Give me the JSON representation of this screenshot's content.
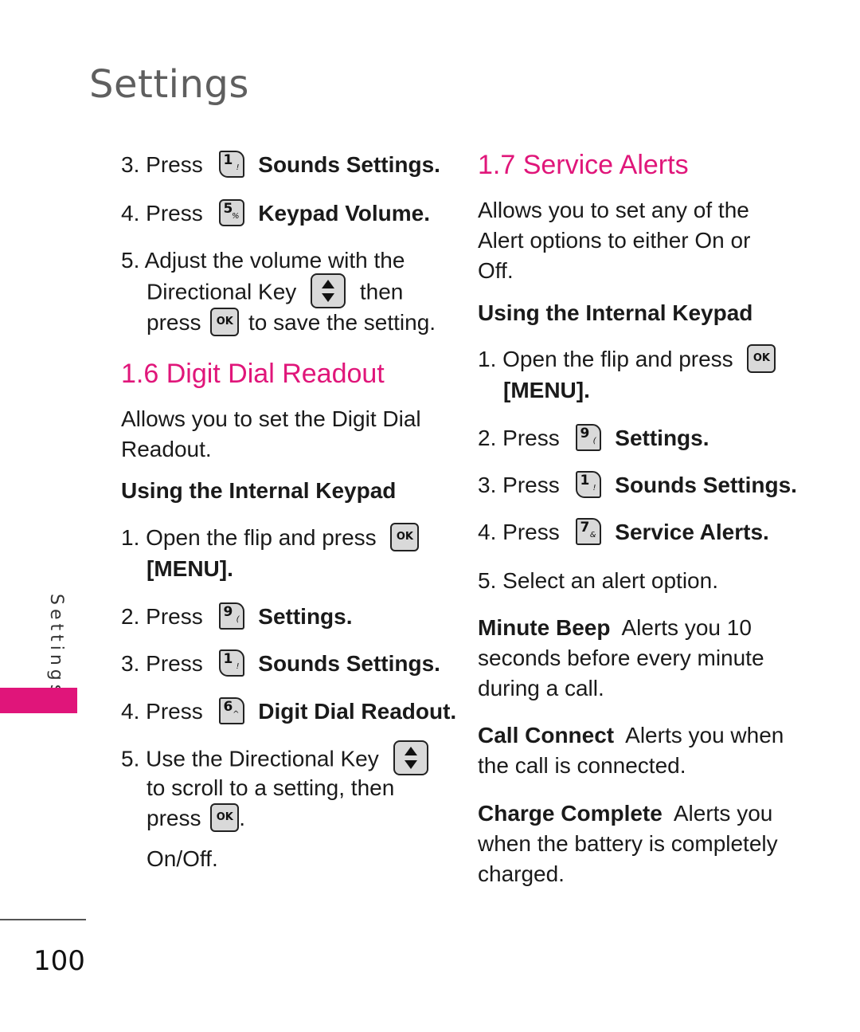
{
  "page": {
    "title": "Settings",
    "side_tab_label": "Settings",
    "page_number": "100",
    "accent_color": "#e0157a"
  },
  "left": {
    "intro_steps": [
      {
        "num": "3.",
        "prefix": "Press",
        "key": {
          "digit": "1",
          "sup": "!",
          "icon": "key-1-icon"
        },
        "label": "Sounds Settings."
      },
      {
        "num": "4.",
        "prefix": "Press",
        "key": {
          "digit": "5",
          "sup": "%",
          "icon": "key-5-icon"
        },
        "label": "Keypad Volume."
      }
    ],
    "step5": {
      "num": "5.",
      "line1": "Adjust the volume with the",
      "line2_a": "Directional Key",
      "line2_b": "then",
      "line3_a": "press",
      "line3_b": "to save the setting.",
      "ok_label": "OK"
    },
    "section": {
      "heading": "1.6 Digit Dial Readout",
      "description_l1": "Allows you to set the Digit Dial",
      "description_l2": "Readout.",
      "subheading": "Using the Internal Keypad",
      "step1": {
        "num": "1.",
        "text": "Open the flip and press",
        "ok_label": "OK",
        "menu": "[MENU]."
      },
      "steps": [
        {
          "num": "2.",
          "prefix": "Press",
          "key": {
            "digit": "9",
            "sup": "(",
            "icon": "key-9-icon"
          },
          "label": "Settings."
        },
        {
          "num": "3.",
          "prefix": "Press",
          "key": {
            "digit": "1",
            "sup": "!",
            "icon": "key-1-icon"
          },
          "label": "Sounds Settings."
        },
        {
          "num": "4.",
          "prefix": "Press",
          "key": {
            "digit": "6",
            "sup": "^",
            "icon": "key-6-icon"
          },
          "label": "Digit Dial Readout."
        }
      ],
      "step5": {
        "num": "5.",
        "line1": "Use the Directional Key",
        "line2": "to scroll to a setting, then",
        "line3": "press",
        "line3_end": ".",
        "ok_label": "OK",
        "option": "On/Off."
      }
    }
  },
  "right": {
    "section": {
      "heading": "1.7 Service Alerts",
      "description": [
        "Allows you to set any of the",
        "Alert options to either On or",
        "Off."
      ],
      "subheading": "Using the Internal Keypad",
      "step1": {
        "num": "1.",
        "text": "Open the flip and press",
        "ok_label": "OK",
        "menu": "[MENU]."
      },
      "steps": [
        {
          "num": "2.",
          "prefix": "Press",
          "key": {
            "digit": "9",
            "sup": "(",
            "icon": "key-9-icon"
          },
          "label": "Settings."
        },
        {
          "num": "3.",
          "prefix": "Press",
          "key": {
            "digit": "1",
            "sup": "!",
            "icon": "key-1-icon"
          },
          "label": "Sounds Settings."
        },
        {
          "num": "4.",
          "prefix": "Press",
          "key": {
            "digit": "7",
            "sup": "&",
            "icon": "key-7-icon"
          },
          "label": "Service Alerts."
        }
      ],
      "step5": {
        "num": "5.",
        "text": "Select an alert option."
      },
      "options": [
        {
          "term": "Minute Beep",
          "lines": [
            "Alerts you 10",
            "seconds before every minute",
            "during a call."
          ]
        },
        {
          "term": "Call Connect",
          "lines": [
            "Alerts you when",
            "the call is connected."
          ]
        },
        {
          "term": "Charge Complete",
          "lines": [
            "Alerts you",
            "when the battery is completely",
            "charged."
          ]
        }
      ]
    }
  }
}
